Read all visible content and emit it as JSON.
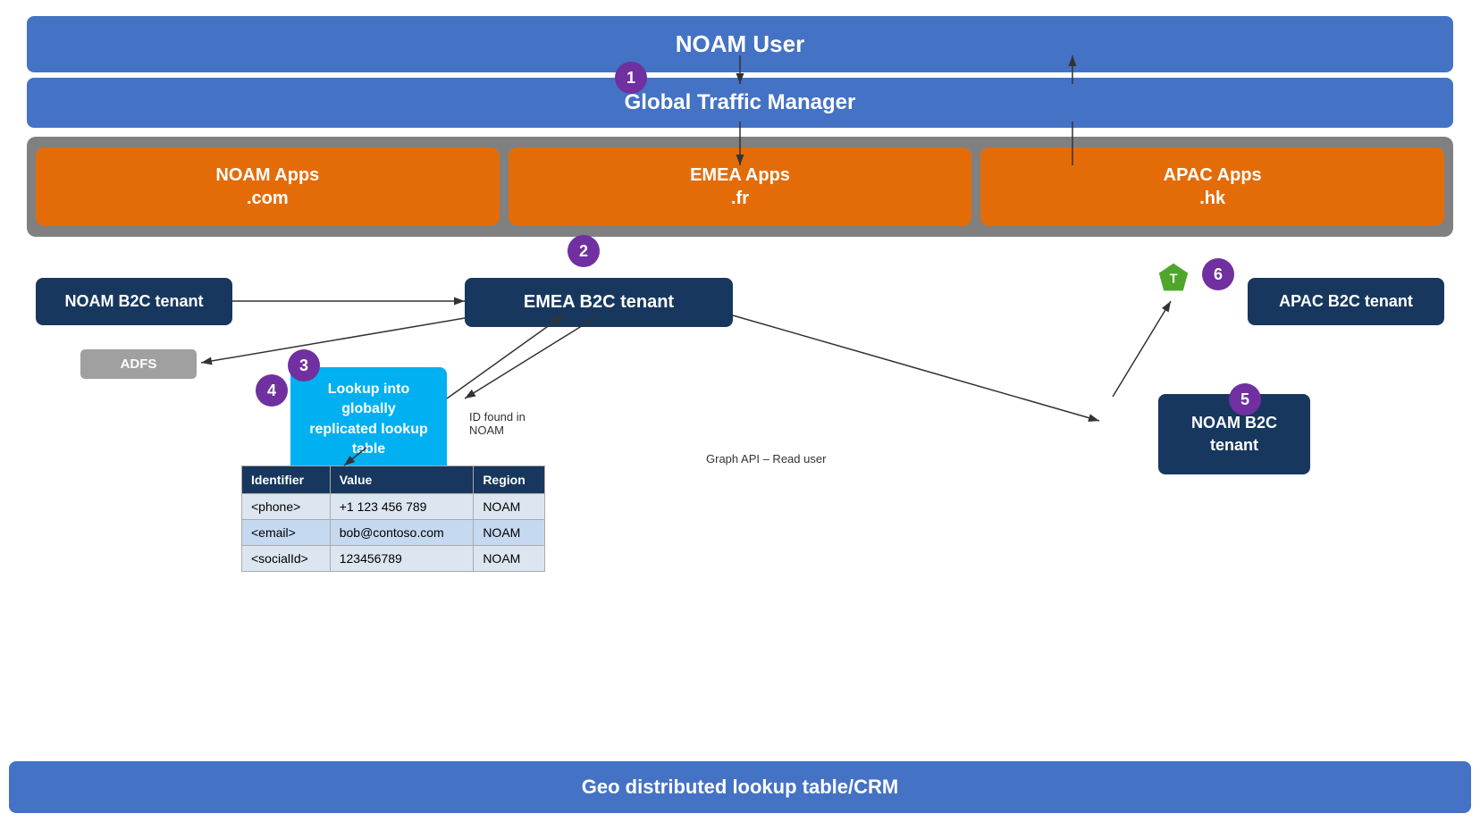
{
  "noam_user": {
    "label": "NOAM User"
  },
  "gtm": {
    "label": "Global Traffic Manager",
    "badge": "1"
  },
  "apps": [
    {
      "id": "noam-app",
      "line1": "NOAM Apps",
      "line2": ".com"
    },
    {
      "id": "emea-app",
      "line1": "EMEA Apps",
      "line2": ".fr"
    },
    {
      "id": "apac-app",
      "line1": "APAC Apps",
      "line2": ".hk"
    }
  ],
  "badges": {
    "b1": "1",
    "b2": "2",
    "b3": "3",
    "b4": "4",
    "b5": "5",
    "b6": "6"
  },
  "tenants": {
    "noam": "NOAM B2C tenant",
    "adfs": "ADFS",
    "emea": "EMEA B2C tenant",
    "apac": "APAC B2C tenant",
    "noam5": {
      "line1": "NOAM B2C",
      "line2": "tenant"
    }
  },
  "lookup_box": {
    "line1": "Lookup into globally",
    "line2": "replicated lookup table"
  },
  "table": {
    "headers": [
      "Identifier",
      "Value",
      "Region"
    ],
    "rows": [
      [
        "<phone>",
        "+1 123 456 789",
        "NOAM"
      ],
      [
        "<email>",
        "bob@contoso.com",
        "NOAM"
      ],
      [
        "<socialId>",
        "123456789",
        "NOAM"
      ]
    ]
  },
  "arrow_labels": {
    "id_found": "ID found in\nNOAM",
    "graph_api": "Graph API – Read user"
  },
  "geo_bar": {
    "label": "Geo distributed lookup table/CRM"
  },
  "colors": {
    "blue_dark": "#17375E",
    "blue_mid": "#4472C4",
    "orange": "#E36C09",
    "purple": "#7030A0",
    "cyan": "#00B0F0",
    "green": "#4EA72A",
    "gray": "#808080"
  }
}
